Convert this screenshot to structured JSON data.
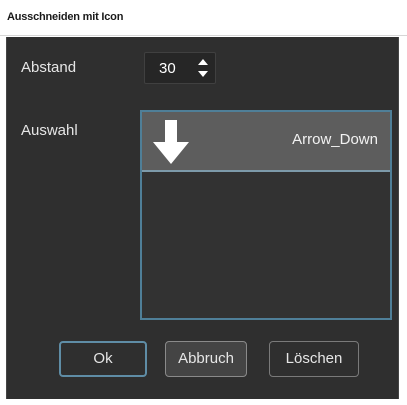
{
  "window": {
    "title": "Ausschneiden mit Icon"
  },
  "form": {
    "spacing_label": "Abstand",
    "spacing_value": "30",
    "selection_label": "Auswahl"
  },
  "list": {
    "items": [
      {
        "label": "Arrow_Down",
        "icon": "arrow-down-icon",
        "selected": true
      }
    ]
  },
  "buttons": {
    "ok_label": "Ok",
    "cancel_label": "Abbruch",
    "delete_label": "Löschen"
  },
  "colors": {
    "dialog_background": "#2f2f2f",
    "accent": "#4f7f98",
    "selected_item": "#5d5d5d"
  }
}
